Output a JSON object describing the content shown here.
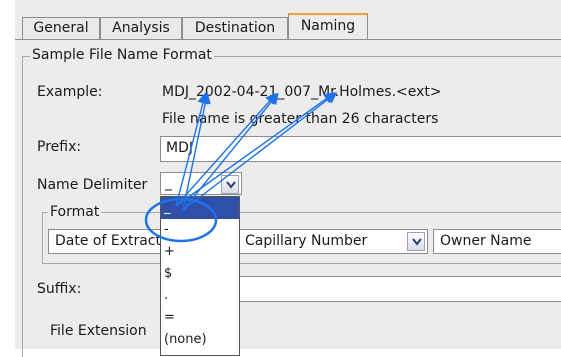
{
  "tabs": [
    {
      "label": "General",
      "active": false
    },
    {
      "label": "Analysis",
      "active": false
    },
    {
      "label": "Destination",
      "active": false
    },
    {
      "label": "Naming",
      "active": true
    }
  ],
  "group_title": "Sample File Name Format",
  "example": {
    "label": "Example:",
    "value": "MDJ_2002-04-21_007_Mr.Holmes.<ext>",
    "warning": "File name is greater than 26 characters"
  },
  "prefix": {
    "label": "Prefix:",
    "value": "MDJ"
  },
  "delimiter": {
    "label": "Name Delimiter",
    "value": "_",
    "options": [
      "_",
      "-",
      "+",
      "$",
      ".",
      "=",
      "(none)"
    ],
    "selected_index": 0
  },
  "format": {
    "title": "Format",
    "fields": [
      "Date of Extraction",
      "Capillary Number",
      "Owner Name"
    ]
  },
  "suffix": {
    "label": "Suffix:",
    "value": ""
  },
  "file_extension": {
    "label": "File Extension"
  },
  "annotation": {
    "color": "#1e73e8"
  }
}
